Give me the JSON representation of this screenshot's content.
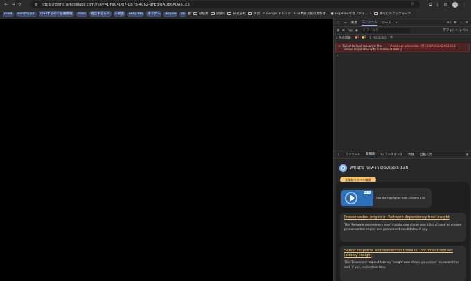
{
  "browser": {
    "url": "https://demo.arkoselabs.com/?key=DF9C4D87-CB7B-4062-9FEB-BADB6ADA61E6",
    "bookmarks_chips": [
      "mind",
      "sass(fcr,eji)",
      "mailするのに必要情報",
      "mask",
      "経営するもの",
      "ai関連",
      "unity-llm",
      "ホラゲー",
      "aicysie",
      "zo"
    ],
    "bookmarks_folders": [
      "試験用",
      "試験作",
      "研究学校",
      "学習",
      "Google トレンド",
      "日本最大級の無料オ...",
      "GigaFile(ギガファイ...",
      "すべてのブックマーク"
    ]
  },
  "devtools": {
    "tabs": [
      "要素",
      "コンソール",
      "ソース"
    ],
    "active_tab": "コンソール",
    "error_count": "1",
    "context": "top",
    "filter_placeholder": "フィルタ",
    "level": "デフォルト レベル",
    "issues_label": "2 件の問題:",
    "issues_err": "1",
    "issues_warn": "1",
    "hidden": "1 件の非表示",
    "error_msg_1": "Failed to load resource: the",
    "error_link": "client-api.arkoselab...9FEB-BADB6ADA61E6:1",
    "error_msg_2": "server responded with a status of 400 ()",
    "prompt": "›"
  },
  "drawer": {
    "tabs": [
      "コンソール",
      "新機能",
      "AI アシスタンス",
      "問題",
      "自動入力"
    ],
    "active_tab": "新機能",
    "title": "What's new in DevTools 138",
    "button": "新機能をすべて確認",
    "highlight": "See the highlights from Chrome 138",
    "new_tag": "NEW",
    "articles": [
      {
        "title": "Preconnected origins in 'Network dependency tree' insight",
        "body": "The 'Network dependency tree' insight now shows you a list of used or unused preconnected origins and preconnect candidates, if any."
      },
      {
        "title": "Server response and redirection times in 'Document request latency' insight",
        "body": "The 'Document request latency' insight now shows you server response time and, if any, redirection time."
      }
    ]
  }
}
